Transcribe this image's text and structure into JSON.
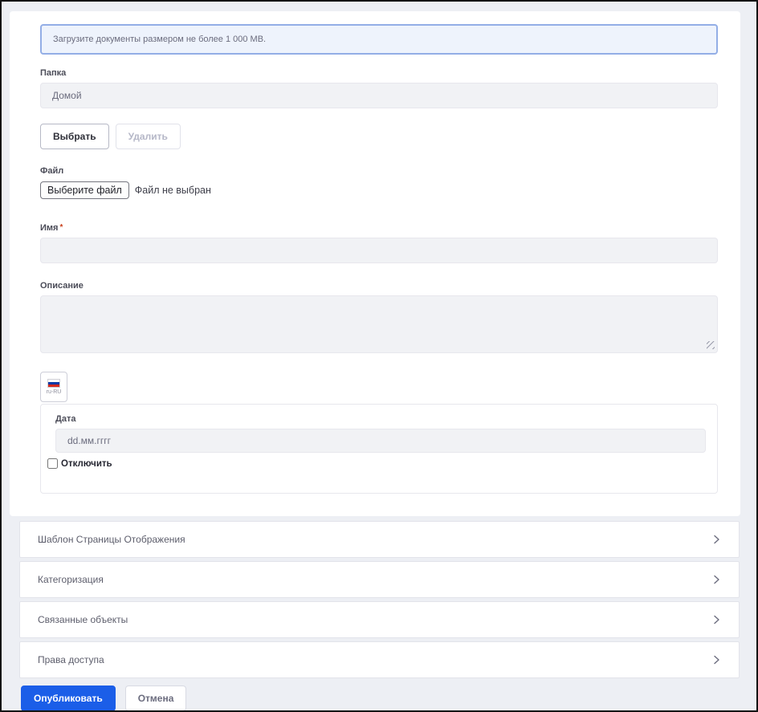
{
  "card": {
    "dropzone": {
      "text": "Загрузите документы размером не более 1 000 MB."
    },
    "folder": {
      "label": "Папка",
      "value": "Домой"
    },
    "folder_actions": {
      "select_label": "Выбрать",
      "remove_label": "Удалить"
    },
    "file": {
      "label": "Файл",
      "button_label": "Выберите файл",
      "status": "Файл не выбран"
    },
    "name": {
      "label": "Имя",
      "required_mark": "*",
      "value": ""
    },
    "description": {
      "label": "Описание",
      "value": ""
    },
    "locale": {
      "code": "ru-RU"
    },
    "date": {
      "label": "Дата",
      "placeholder": "dd.мм.гггг",
      "value": "",
      "checkbox_label": "Отключить",
      "checked": false
    }
  },
  "accordions": [
    {
      "label": "Шаблон Страницы Отображения"
    },
    {
      "label": "Категоризация"
    },
    {
      "label": "Связанные объекты"
    },
    {
      "label": "Права доступа"
    }
  ],
  "footer": {
    "publish_label": "Опубликовать",
    "cancel_label": "Отмена"
  },
  "icons": {
    "accordion_chevron": "chevron-right-icon",
    "locale_flag": "ru-flag-icon",
    "textarea_grip": "resize-grip-icon"
  },
  "colors": {
    "primary": "#1b5ee8",
    "page_bg": "#edeff4",
    "input_bg": "#f1f2f5",
    "input_border": "#e7e7ed",
    "dropzone_bg": "#eef3fc",
    "dropzone_border": "#93aee6",
    "muted_text": "#6b6c7e",
    "required_mark": "#c9411d",
    "flag_blue": "#0039a6",
    "flag_red": "#d52b1e"
  }
}
